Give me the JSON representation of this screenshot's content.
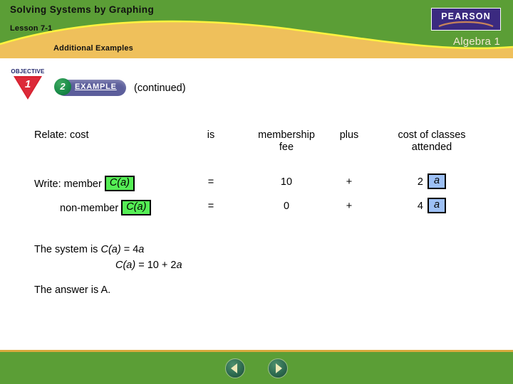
{
  "header": {
    "title": "Solving Systems by Graphing",
    "lesson": "Lesson 7-1",
    "section": "Additional Examples",
    "brand_logo_text": "PEARSON",
    "brand_subtitle": "Algebra 1",
    "green": "#5b9e36",
    "gold": "#efc05b",
    "logo_bg": "#3b2a80"
  },
  "badges": {
    "objective_word": "OBJECTIVE",
    "objective_number": "1",
    "objective_color": "#d6202e",
    "example_label": "EXAMPLE",
    "example_number": "2",
    "example_pill_color": "#5c5e9b",
    "continued": "(continued)"
  },
  "table": {
    "relate": {
      "label": "Relate:  cost",
      "is": "is",
      "fee": "membership\nfee",
      "plus": "plus",
      "classes": "cost of classes\nattended"
    },
    "write_member": {
      "prefix": "Write:  member",
      "variable": "C(a)",
      "equals": "=",
      "fee_value": "10",
      "operator": "+",
      "coefficient": "2",
      "coef_variable": "a"
    },
    "write_nonmember": {
      "prefix": "non-member",
      "variable": "C(a)",
      "equals": "=",
      "fee_value": "0",
      "operator": "+",
      "coefficient": "4",
      "coef_variable": "a"
    },
    "highlight_green": "#55ee55",
    "highlight_blue": "#9dc0f5"
  },
  "summary": {
    "system_intro": "The system is ",
    "system_eq_1_fn": "C(a)",
    "system_eq_1_rest": " = 4",
    "system_eq_1_var": "a",
    "system_eq_2_fn": "C(a)",
    "system_eq_2_rest": " = 10 + 2",
    "system_eq_2_var": "a",
    "answer": "The answer is A."
  },
  "footer": {
    "back_label": "Back",
    "forward_label": "Forward",
    "bar_color": "#5b9e36",
    "rule_color": "#d8a93d"
  }
}
